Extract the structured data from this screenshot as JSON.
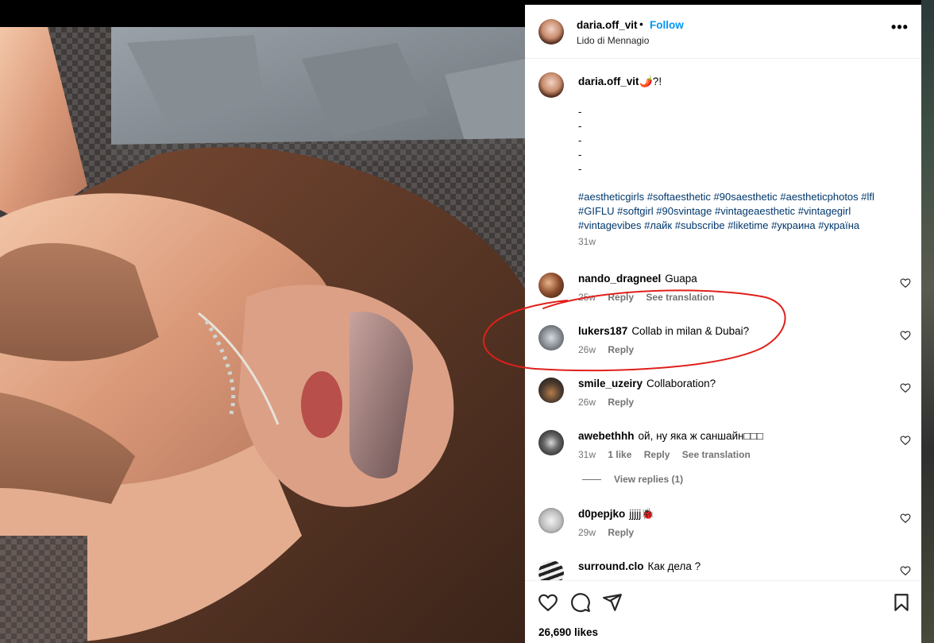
{
  "post": {
    "author": "daria.off_vit",
    "follow_label": "Follow",
    "separator": "•",
    "location": "Lido di Mennagio",
    "more_label": "•••"
  },
  "caption": {
    "author": "daria.off_vit",
    "text": "🌶️?!",
    "dashes": [
      "-",
      "-",
      "-",
      "-",
      "-"
    ],
    "hashtags": "#aestheticgirls #softaesthetic #90saesthetic #aestheticphotos #lfl #GIFLU #softgirl #90svintage #vintageaesthetic #vintagegirl #vintagevibes #лайк #subscribe #liketime #украина #україна",
    "time": "31w"
  },
  "comments": [
    {
      "user": "nando_dragneel",
      "text": "Guapa",
      "time": "25w",
      "likes": "",
      "reply": "Reply",
      "translate": "See translation"
    },
    {
      "user": "lukers187",
      "text": "Collab in milan & Dubai?",
      "time": "26w",
      "likes": "",
      "reply": "Reply",
      "translate": ""
    },
    {
      "user": "smile_uzeiry",
      "text": "Collaboration?",
      "time": "26w",
      "likes": "",
      "reply": "Reply",
      "translate": ""
    },
    {
      "user": "awebethhh",
      "text": "ой, ну яка ж саншайн□□□",
      "time": "31w",
      "likes": "1 like",
      "reply": "Reply",
      "translate": "See translation"
    },
    {
      "user": "d0pepjko",
      "text": "jjjjj🐞",
      "time": "29w",
      "likes": "",
      "reply": "Reply",
      "translate": ""
    },
    {
      "user": "surround.clo",
      "text": "Как дела ?",
      "time": "",
      "likes": "",
      "reply": "",
      "translate": ""
    }
  ],
  "view_replies": "View replies (1)",
  "likes_count": "26,690 likes",
  "colors": {
    "accent": "#0095f6",
    "hashtag": "#00376b",
    "muted": "#737373",
    "annotation": "#e0201b"
  },
  "icons": [
    "more-icon",
    "heart-icon",
    "comment-icon",
    "share-icon",
    "bookmark-icon"
  ]
}
